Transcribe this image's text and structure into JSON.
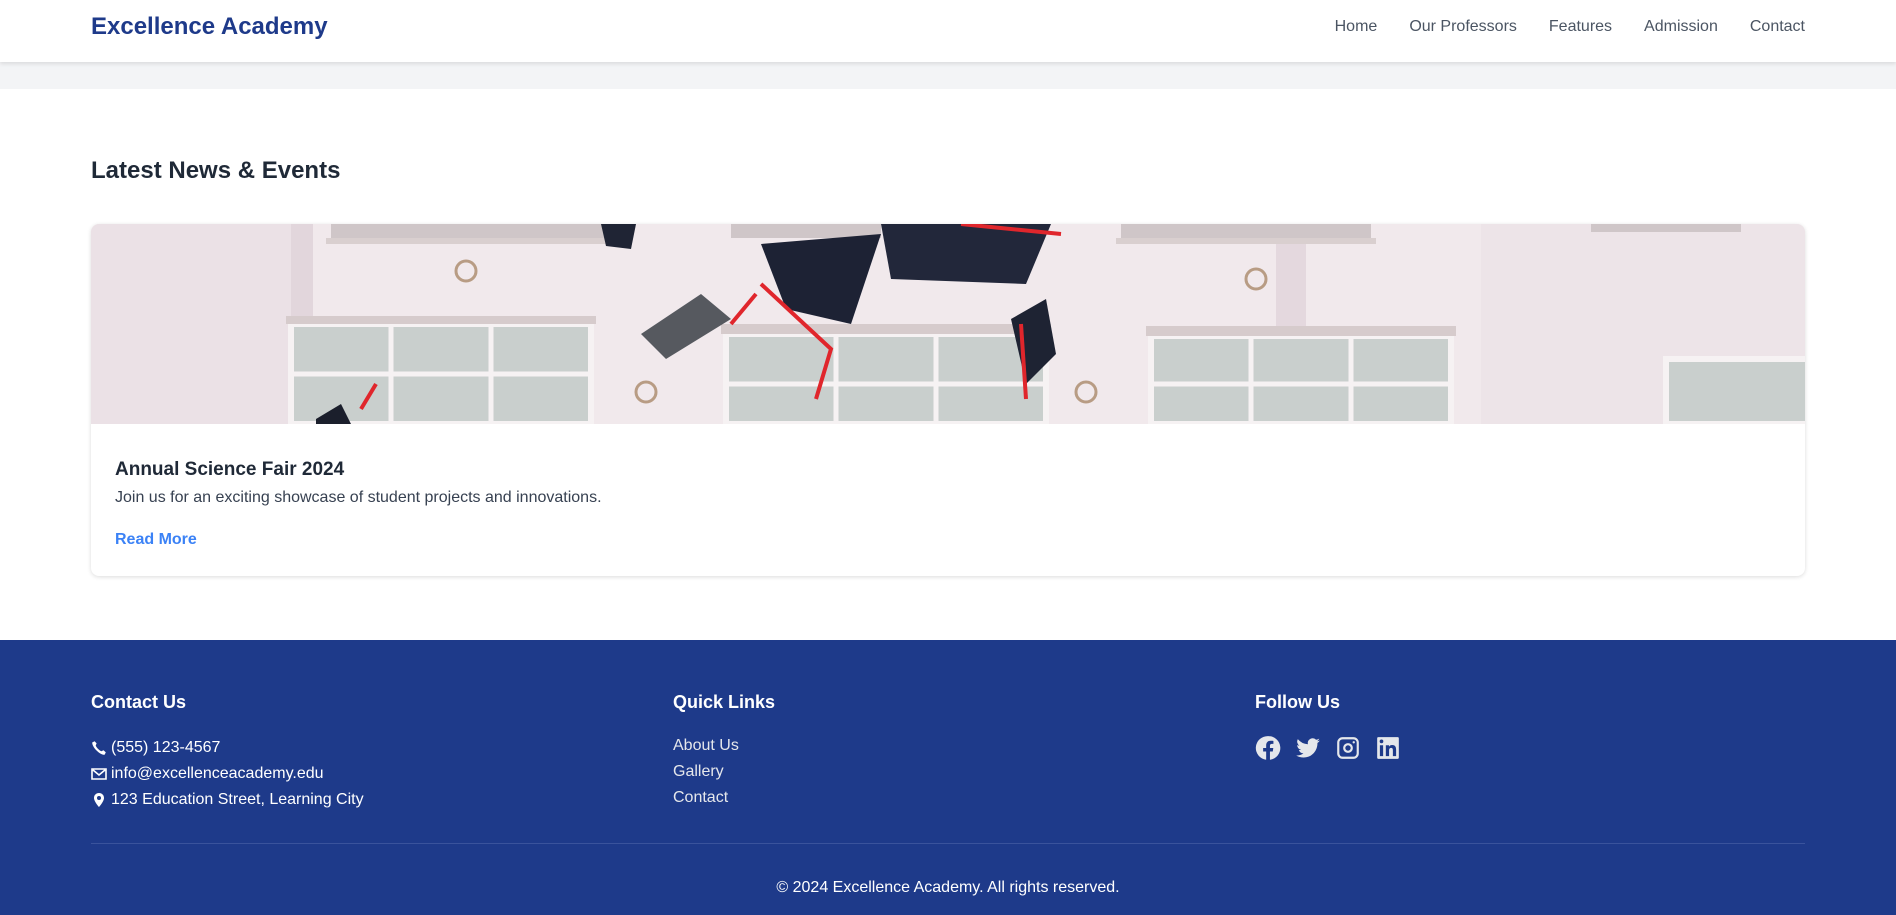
{
  "header": {
    "brand": "Excellence Academy",
    "nav": [
      "Home",
      "Our Professors",
      "Features",
      "Admission",
      "Contact"
    ]
  },
  "news": {
    "title": "Latest News & Events",
    "card": {
      "image_description": "",
      "title": "Annual Science Fair 2024",
      "text": "Join us for an exciting showcase of student projects and innovations.",
      "link": "Read More"
    }
  },
  "footer": {
    "contact": {
      "title": "Contact Us",
      "phone": "(555) 123-4567",
      "email": "info@excellenceacademy.edu",
      "address": "123 Education Street, Learning City"
    },
    "quick_links": {
      "title": "Quick Links",
      "items": [
        "About Us",
        "Gallery",
        "Contact"
      ]
    },
    "social": {
      "title": "Follow Us",
      "icons": [
        "facebook-icon",
        "twitter-icon",
        "instagram-icon",
        "linkedin-icon"
      ]
    },
    "copyright": "© 2024 Excellence Academy. All rights reserved."
  },
  "colors": {
    "brand": "#1e3a8a",
    "link": "#3b82f6",
    "footer_bg": "#1e3a8a"
  }
}
